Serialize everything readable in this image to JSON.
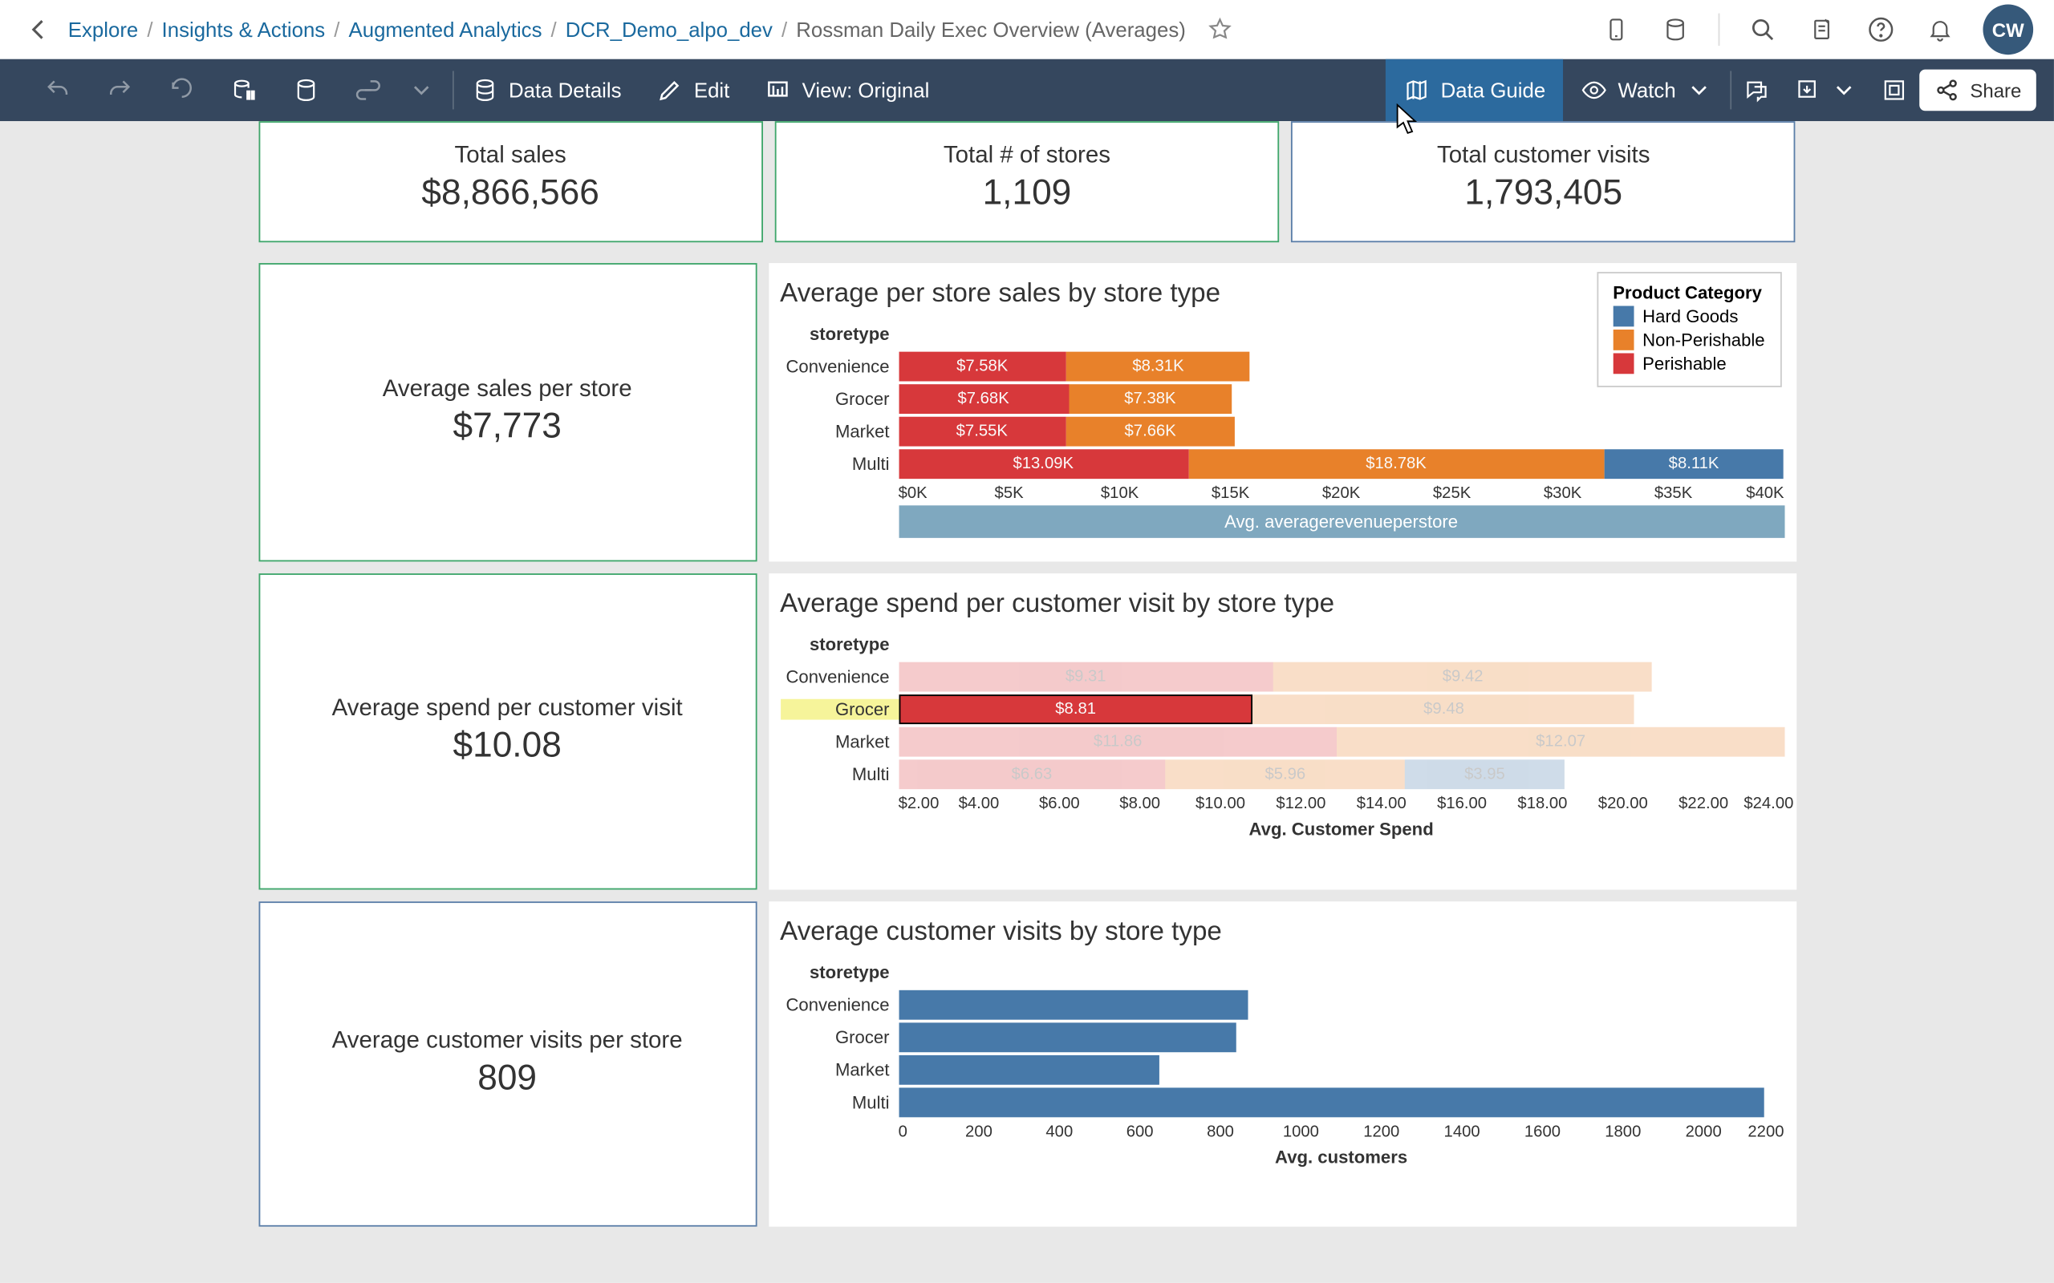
{
  "breadcrumb": {
    "items": [
      "Explore",
      "Insights & Actions",
      "Augmented Analytics",
      "DCR_Demo_alpo_dev"
    ],
    "current": "Rossman Daily Exec Overview (Averages)"
  },
  "avatar": "CW",
  "toolbar": {
    "data_details": "Data Details",
    "edit": "Edit",
    "view_label": "View: Original",
    "data_guide": "Data Guide",
    "watch": "Watch",
    "share": "Share"
  },
  "kpis": {
    "total_sales": {
      "title": "Total sales",
      "value": "$8,866,566"
    },
    "total_stores": {
      "title": "Total # of stores",
      "value": "1,109"
    },
    "total_visits": {
      "title": "Total customer visits",
      "value": "1,793,405"
    },
    "avg_sales": {
      "title": "Average sales per store",
      "value": "$7,773"
    },
    "avg_spend": {
      "title": "Average spend per customer visit",
      "value": "$10.08"
    },
    "avg_visits": {
      "title": "Average customer visits per store",
      "value": "809"
    }
  },
  "legend": {
    "header": "Product Category",
    "items": [
      "Hard Goods",
      "Non-Perishable",
      "Perishable"
    ]
  },
  "axis_header": "storetype",
  "chart1": {
    "title": "Average per store sales by store type",
    "xlabel": "Avg. averagerevenueperstore",
    "categories": [
      "Convenience",
      "Grocer",
      "Market",
      "Multi"
    ]
  },
  "chart2": {
    "title": "Average spend per customer visit by store type",
    "xlabel": "Avg. Customer Spend",
    "categories": [
      "Convenience",
      "Grocer",
      "Market",
      "Multi"
    ]
  },
  "chart3": {
    "title": "Average customer visits by store type",
    "xlabel": "Avg. customers",
    "categories": [
      "Convenience",
      "Grocer",
      "Market",
      "Multi"
    ]
  },
  "chart_data": [
    {
      "type": "bar",
      "orientation": "horizontal",
      "stacked": true,
      "title": "Average per store sales by store type",
      "ylabel": "storetype",
      "xlabel": "Avg. averagerevenueperstore",
      "xlim": [
        0,
        40000
      ],
      "xticks": [
        "$0K",
        "$5K",
        "$10K",
        "$15K",
        "$20K",
        "$25K",
        "$30K",
        "$35K",
        "$40K"
      ],
      "categories": [
        "Convenience",
        "Grocer",
        "Market",
        "Multi"
      ],
      "series": [
        {
          "name": "Perishable",
          "color": "#d7383b",
          "values": [
            7580,
            7680,
            7550,
            13090
          ],
          "labels": [
            "$7.58K",
            "$7.68K",
            "$7.55K",
            "$13.09K"
          ]
        },
        {
          "name": "Non-Perishable",
          "color": "#e8812a",
          "values": [
            8310,
            7380,
            7660,
            18780
          ],
          "labels": [
            "$8.31K",
            "$7.38K",
            "$7.66K",
            "$18.78K"
          ]
        },
        {
          "name": "Hard Goods",
          "color": "#4779a9",
          "values": [
            null,
            null,
            null,
            8110
          ],
          "labels": [
            null,
            null,
            null,
            "$8.11K"
          ]
        }
      ]
    },
    {
      "type": "bar",
      "orientation": "horizontal",
      "stacked": true,
      "title": "Average spend per customer visit by store type",
      "ylabel": "storetype",
      "xlabel": "Avg. Customer Spend",
      "xlim": [
        2,
        24
      ],
      "xticks": [
        "$2.00",
        "$4.00",
        "$6.00",
        "$8.00",
        "$10.00",
        "$12.00",
        "$14.00",
        "$16.00",
        "$18.00",
        "$20.00",
        "$22.00",
        "$24.00"
      ],
      "categories": [
        "Convenience",
        "Grocer",
        "Market",
        "Multi"
      ],
      "highlighted_category": "Grocer",
      "selected": {
        "category": "Grocer",
        "series": "Perishable"
      },
      "series": [
        {
          "name": "Perishable",
          "color": "#d7383b",
          "values": [
            9.31,
            8.81,
            11.86,
            6.63
          ],
          "labels": [
            "$9.31",
            "$8.81",
            "$11.86",
            "$6.63"
          ]
        },
        {
          "name": "Non-Perishable",
          "color": "#e8812a",
          "values": [
            9.42,
            9.48,
            12.07,
            5.96
          ],
          "labels": [
            "$9.42",
            "$9.48",
            "$12.07",
            "$5.96"
          ]
        },
        {
          "name": "Hard Goods",
          "color": "#4779a9",
          "values": [
            null,
            null,
            null,
            3.95
          ],
          "labels": [
            null,
            null,
            null,
            "$3.95"
          ]
        }
      ]
    },
    {
      "type": "bar",
      "orientation": "horizontal",
      "stacked": false,
      "title": "Average customer visits by store type",
      "ylabel": "storetype",
      "xlabel": "Avg. customers",
      "xlim": [
        0,
        2200
      ],
      "xticks": [
        "0",
        "200",
        "400",
        "600",
        "800",
        "1000",
        "1200",
        "1400",
        "1600",
        "1800",
        "2000",
        "2200"
      ],
      "categories": [
        "Convenience",
        "Grocer",
        "Market",
        "Multi"
      ],
      "series": [
        {
          "name": "Avg. customers",
          "color": "#4779a9",
          "values": [
            870,
            840,
            650,
            2150
          ]
        }
      ]
    }
  ]
}
